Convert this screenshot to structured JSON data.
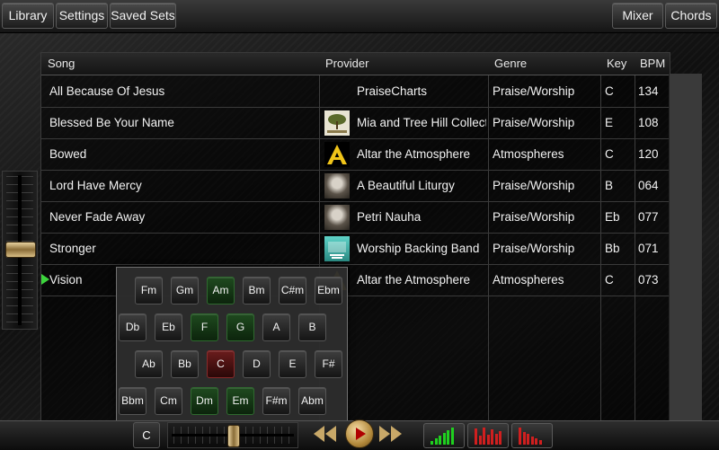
{
  "toolbar": {
    "library": "Library",
    "settings": "Settings",
    "saved_sets": "Saved Sets",
    "mixer": "Mixer",
    "chords": "Chords"
  },
  "table": {
    "headers": {
      "song": "Song",
      "provider": "Provider",
      "genre": "Genre",
      "key": "Key",
      "bpm": "BPM"
    },
    "rows": [
      {
        "song": "All Because Of Jesus",
        "provider": "PraiseCharts",
        "genre": "Praise/Worship",
        "key": "C",
        "bpm": "134",
        "thumb": "none"
      },
      {
        "song": "Blessed Be Your Name",
        "provider": "Mia and Tree Hill Collective",
        "genre": "Praise/Worship",
        "key": "E",
        "bpm": "108",
        "thumb": "tree-icon"
      },
      {
        "song": "Bowed",
        "provider": "Altar the Atmosphere",
        "genre": "Atmospheres",
        "key": "C",
        "bpm": "120",
        "thumb": "altar-logo-icon"
      },
      {
        "song": "Lord Have Mercy",
        "provider": "A Beautiful Liturgy",
        "genre": "Praise/Worship",
        "key": "B",
        "bpm": "064",
        "thumb": "portrait-photo-icon"
      },
      {
        "song": "Never Fade Away",
        "provider": "Petri Nauha",
        "genre": "Praise/Worship",
        "key": "Eb",
        "bpm": "077",
        "thumb": "portrait-photo-icon"
      },
      {
        "song": "Stronger",
        "provider": "Worship Backing Band",
        "genre": "Praise/Worship",
        "key": "Bb",
        "bpm": "071",
        "thumb": "backing-band-icon"
      },
      {
        "song": "Vision",
        "provider": "Altar the Atmosphere",
        "genre": "Atmospheres",
        "key": "C",
        "bpm": "073",
        "thumb": "altar-logo-icon",
        "playing": true
      }
    ]
  },
  "chord_panel": {
    "rows": [
      [
        {
          "label": "Fm",
          "state": "normal"
        },
        {
          "label": "Gm",
          "state": "normal"
        },
        {
          "label": "Am",
          "state": "green"
        },
        {
          "label": "Bm",
          "state": "normal"
        },
        {
          "label": "C#m",
          "state": "normal"
        },
        {
          "label": "Ebm",
          "state": "normal"
        }
      ],
      [
        {
          "label": "Db",
          "state": "normal"
        },
        {
          "label": "Eb",
          "state": "normal"
        },
        {
          "label": "F",
          "state": "green"
        },
        {
          "label": "G",
          "state": "green"
        },
        {
          "label": "A",
          "state": "normal"
        },
        {
          "label": "B",
          "state": "normal"
        }
      ],
      [
        {
          "label": "Ab",
          "state": "normal"
        },
        {
          "label": "Bb",
          "state": "normal"
        },
        {
          "label": "C",
          "state": "red"
        },
        {
          "label": "D",
          "state": "normal"
        },
        {
          "label": "E",
          "state": "normal"
        },
        {
          "label": "F#",
          "state": "normal"
        }
      ],
      [
        {
          "label": "Bbm",
          "state": "normal"
        },
        {
          "label": "Cm",
          "state": "normal"
        },
        {
          "label": "Dm",
          "state": "green"
        },
        {
          "label": "Em",
          "state": "green"
        },
        {
          "label": "F#m",
          "state": "normal"
        },
        {
          "label": "Abm",
          "state": "normal"
        }
      ]
    ]
  },
  "transport": {
    "key_label": "C",
    "pitch_slider_value": 0.5,
    "volume_slider_value": 0.52
  },
  "meters": [
    {
      "name": "green-level-meter",
      "color": "#1fd01f",
      "levels": [
        0.2,
        0.35,
        0.5,
        0.65,
        0.8,
        0.95
      ]
    },
    {
      "name": "red-level-meter-1",
      "color": "#d01f1f",
      "levels": [
        0.9,
        0.5,
        0.95,
        0.55,
        0.85,
        0.6,
        0.75
      ]
    },
    {
      "name": "red-level-meter-2",
      "color": "#d01f1f",
      "levels": [
        0.95,
        0.7,
        0.6,
        0.45,
        0.35,
        0.25
      ]
    }
  ],
  "colors": {
    "accent_green": "#3cd43c",
    "slider_gold": "#c8a868",
    "playing_red": "#b00000"
  }
}
